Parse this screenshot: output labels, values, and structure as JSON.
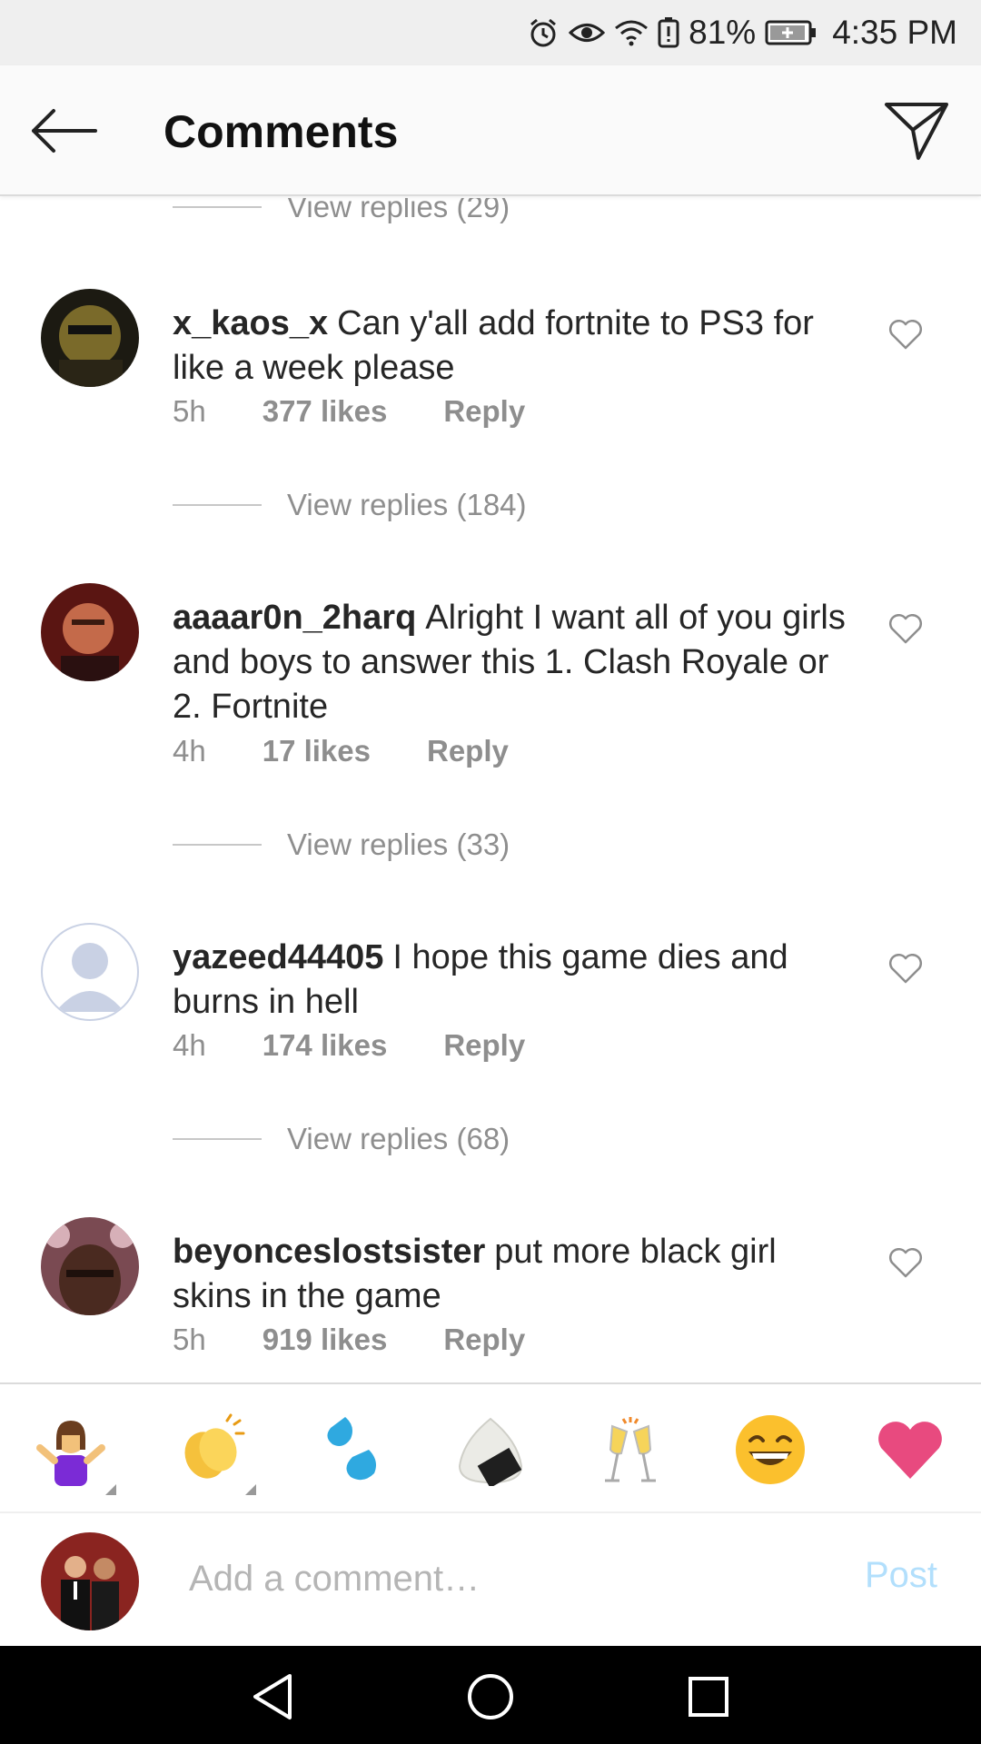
{
  "status_bar": {
    "battery_percent": "81%",
    "time": "4:35 PM",
    "icons": [
      "alarm-icon",
      "eye-icon",
      "wifi-icon",
      "battery-alert-icon",
      "battery-icon"
    ]
  },
  "header": {
    "title": "Comments",
    "back_icon": "arrow-left-icon",
    "send_icon": "paper-plane-icon"
  },
  "comments": {
    "top_view_replies": "View replies (29)",
    "items": [
      {
        "username": "x_kaos_x",
        "text": "Can y'all add fortnite to PS3 for like a week please",
        "time": "5h",
        "likes": "377 likes",
        "reply": "Reply",
        "view_replies": "View replies (184)",
        "avatar_colors": [
          "#1c1a12",
          "#7a6a2a"
        ]
      },
      {
        "username": "aaaar0n_2harq",
        "text": "Alright I want all of you girls and boys to answer this 1. Clash Royale or 2. Fortnite",
        "time": "4h",
        "likes": "17 likes",
        "reply": "Reply",
        "view_replies": "View replies (33)",
        "avatar_colors": [
          "#5a1512",
          "#c46a4a"
        ]
      },
      {
        "username": "yazeed44405",
        "text": "I hope this game dies and burns in hell",
        "time": "4h",
        "likes": "174 likes",
        "reply": "Reply",
        "view_replies": "View replies (68)",
        "avatar_colors": [
          "#c9d1e4",
          "#ffffff"
        ]
      },
      {
        "username": "beyonceslostsister",
        "text": "put more black girl skins in the game",
        "time": "5h",
        "likes": "919 likes",
        "reply": "Reply",
        "avatar_colors": [
          "#7a4a52",
          "#d7b0b8"
        ]
      }
    ]
  },
  "emoji_bar": [
    "person-shrugging-emoji",
    "clapping-hands-emoji",
    "sweat-droplets-emoji",
    "rice-ball-emoji",
    "clinking-glasses-emoji",
    "grinning-face-emoji",
    "red-heart-emoji"
  ],
  "compose": {
    "placeholder": "Add a comment…",
    "post_label": "Post"
  },
  "nav_bar": [
    "back-triangle-icon",
    "home-circle-icon",
    "recents-square-icon"
  ],
  "colors": {
    "accent_post_disabled": "#b2dffc",
    "meta_gray": "#8e8e8e",
    "heart": "#e84a7f"
  }
}
